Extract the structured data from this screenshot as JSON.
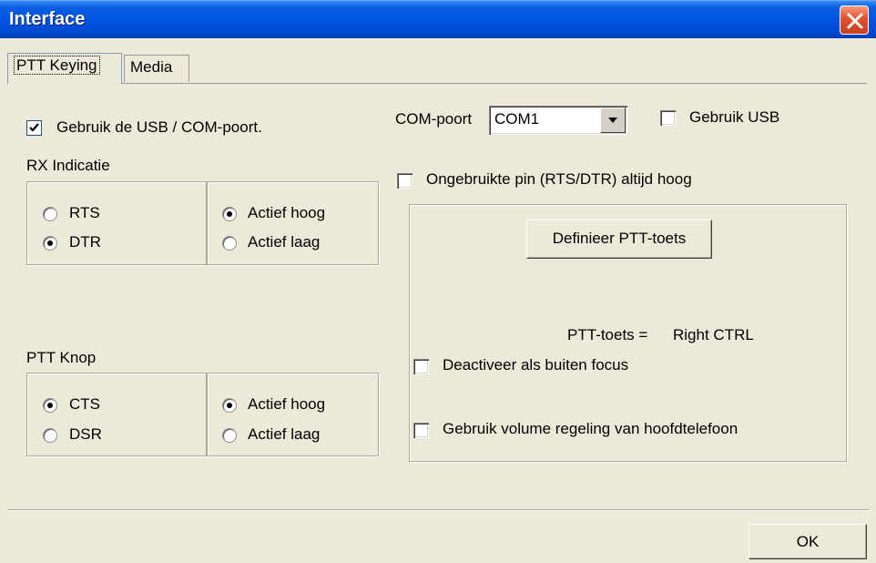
{
  "window": {
    "title": "Interface"
  },
  "tabs": [
    {
      "label": "PTT Keying"
    },
    {
      "label": "Media"
    }
  ],
  "usb": {
    "use_usb_com_label": "Gebruik de USB / COM-poort.",
    "use_usb_com_checked": true,
    "com_port_label": "COM-poort",
    "com_port_value": "COM1",
    "use_usb_label": "Gebruik USB",
    "use_usb_checked": false,
    "unused_pin_label": "Ongebruikte pin (RTS/DTR) altijd hoog",
    "unused_pin_checked": false
  },
  "rx": {
    "heading": "RX Indicatie",
    "line_options": [
      {
        "label": "RTS",
        "selected": false
      },
      {
        "label": "DTR",
        "selected": true
      }
    ],
    "level_options": [
      {
        "label": "Actief hoog",
        "selected": true
      },
      {
        "label": "Actief laag",
        "selected": false
      }
    ]
  },
  "ptt": {
    "heading": "PTT Knop",
    "line_options": [
      {
        "label": "CTS",
        "selected": true
      },
      {
        "label": "DSR",
        "selected": false
      }
    ],
    "level_options": [
      {
        "label": "Actief hoog",
        "selected": true
      },
      {
        "label": "Actief laag",
        "selected": false
      }
    ]
  },
  "ptt_key": {
    "define_button": "Definieer PTT-toets",
    "key_label": "PTT-toets =",
    "key_value": "Right CTRL",
    "deactivate_label": "Deactiveer als buiten focus",
    "deactivate_checked": false,
    "headphone_volume_label": "Gebruik volume regeling van hoofdtelefoon",
    "headphone_volume_checked": false
  },
  "footer": {
    "ok_label": "OK"
  }
}
